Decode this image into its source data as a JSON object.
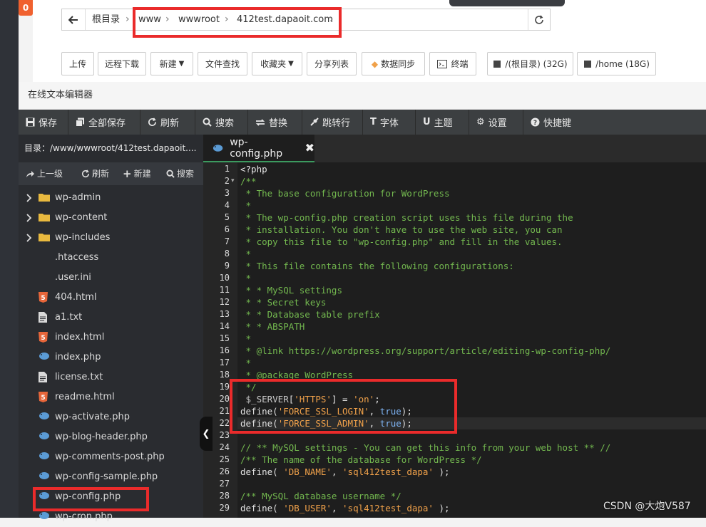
{
  "notification_badge": "0",
  "path_bar": {
    "crumbs": [
      "根目录",
      "www",
      "wwwroot",
      "412test.dapaoit.com"
    ]
  },
  "toolbar": {
    "upload": "上传",
    "remote_download": "远程下载",
    "new": "新建",
    "file_search": "文件查找",
    "favorites": "收藏夹",
    "share_list": "分享列表",
    "data_sync": "数据同步",
    "terminal": "终端",
    "disk_root": "/(根目录) (32G)",
    "disk_home": "/home (18G)"
  },
  "editor": {
    "title": "在线文本编辑器",
    "toolbar": [
      "保存",
      "全部保存",
      "刷新",
      "搜索",
      "替换",
      "跳转行",
      "字体",
      "主题",
      "设置",
      "快捷键"
    ],
    "directory_label": "目录：/www/wwwroot/412test.dapaoit....",
    "side_actions": [
      "上一级",
      "刷新",
      "新建",
      "搜索"
    ],
    "active_tab": "wp-config.php",
    "files": [
      {
        "name": "wp-admin",
        "type": "folder"
      },
      {
        "name": "wp-content",
        "type": "folder"
      },
      {
        "name": "wp-includes",
        "type": "folder"
      },
      {
        "name": ".htaccess",
        "type": "plain"
      },
      {
        "name": ".user.ini",
        "type": "plain"
      },
      {
        "name": "404.html",
        "type": "html"
      },
      {
        "name": "a1.txt",
        "type": "text"
      },
      {
        "name": "index.html",
        "type": "html"
      },
      {
        "name": "index.php",
        "type": "php"
      },
      {
        "name": "license.txt",
        "type": "text"
      },
      {
        "name": "readme.html",
        "type": "html"
      },
      {
        "name": "wp-activate.php",
        "type": "php"
      },
      {
        "name": "wp-blog-header.php",
        "type": "php"
      },
      {
        "name": "wp-comments-post.php",
        "type": "php"
      },
      {
        "name": "wp-config-sample.php",
        "type": "php"
      },
      {
        "name": "wp-config.php",
        "type": "php"
      },
      {
        "name": "wp-cron.php",
        "type": "php"
      }
    ],
    "code_lines": [
      {
        "n": "1",
        "t": "<?php",
        "c": "fn"
      },
      {
        "n": "2",
        "t": "/**",
        "c": "cm",
        "fold": true
      },
      {
        "n": "3",
        "t": " * The base configuration for WordPress",
        "c": "cm"
      },
      {
        "n": "4",
        "t": " *",
        "c": "cm"
      },
      {
        "n": "5",
        "t": " * The wp-config.php creation script uses this file during the",
        "c": "cm"
      },
      {
        "n": "6",
        "t": " * installation. You don't have to use the web site, you can",
        "c": "cm"
      },
      {
        "n": "7",
        "t": " * copy this file to \"wp-config.php\" and fill in the values.",
        "c": "cm"
      },
      {
        "n": "8",
        "t": " *",
        "c": "cm"
      },
      {
        "n": "9",
        "t": " * This file contains the following configurations:",
        "c": "cm"
      },
      {
        "n": "10",
        "t": " *",
        "c": "cm"
      },
      {
        "n": "11",
        "t": " * * MySQL settings",
        "c": "cm"
      },
      {
        "n": "12",
        "t": " * * Secret keys",
        "c": "cm"
      },
      {
        "n": "13",
        "t": " * * Database table prefix",
        "c": "cm"
      },
      {
        "n": "14",
        "t": " * * ABSPATH",
        "c": "cm"
      },
      {
        "n": "15",
        "t": " *",
        "c": "cm"
      },
      {
        "n": "16",
        "t": " * @link https://wordpress.org/support/article/editing-wp-config-php/",
        "c": "cm"
      },
      {
        "n": "17",
        "t": " *",
        "c": "cm"
      },
      {
        "n": "18",
        "t": " * @package WordPress",
        "c": "cm"
      },
      {
        "n": "19",
        "t": " */",
        "c": "cm"
      },
      {
        "n": "20",
        "t": " $_SERVER['HTTPS'] = 'on';",
        "c": "mix1"
      },
      {
        "n": "21",
        "t": "define('FORCE_SSL_LOGIN', true);",
        "c": "mix2"
      },
      {
        "n": "22",
        "t": "define('FORCE_SSL_ADMIN', true);",
        "c": "mix3"
      },
      {
        "n": "23",
        "t": "",
        "c": "fn"
      },
      {
        "n": "24",
        "t": "// ** MySQL settings - You can get this info from your web host ** //",
        "c": "cm"
      },
      {
        "n": "25",
        "t": "/** The name of the database for WordPress */",
        "c": "cm"
      },
      {
        "n": "26",
        "t": "define( 'DB_NAME', 'sql412test_dapa' );",
        "c": "mix4"
      },
      {
        "n": "27",
        "t": "",
        "c": "fn"
      },
      {
        "n": "28",
        "t": "/** MySQL database username */",
        "c": "cm"
      },
      {
        "n": "29",
        "t": "define( 'DB_USER', 'sql412test_dapa' );",
        "c": "mix5"
      }
    ]
  },
  "watermark": "CSDN @大炮V587",
  "colors": {
    "accent_red": "#ea2b2b",
    "badge_orange": "#f0612f",
    "folder_yellow": "#e8b93f",
    "html_orange": "#e7663a",
    "php_blue": "#5b9bd5",
    "comment_green": "#73b84f",
    "string_orange": "#f0a14a",
    "keyword_blue": "#7fb5f5"
  }
}
